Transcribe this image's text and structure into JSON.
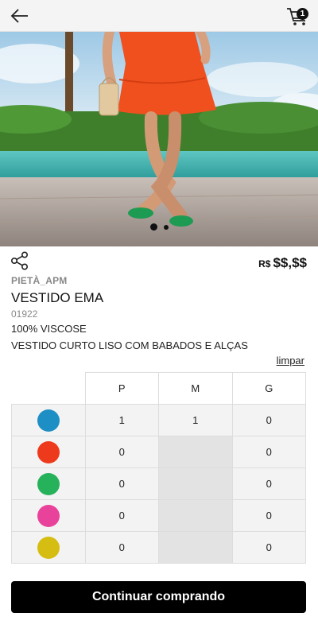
{
  "header": {
    "back_icon": "arrow-left-icon",
    "cart_icon": "cart-icon",
    "cart_count": "1"
  },
  "gallery": {
    "slide_count": 2,
    "active_index": 0,
    "image_description_icon": "product-photo"
  },
  "product": {
    "share_icon": "share-icon",
    "currency": "R$",
    "price": "$$,$$",
    "brand": "PIETÀ_APM",
    "name": "VESTIDO EMA",
    "code": "01922",
    "material": "100% VISCOSE",
    "description": "VESTIDO CURTO LISO COM BABADOS E ALÇAS"
  },
  "size_grid": {
    "clear_label": "limpar",
    "sizes": [
      "P",
      "M",
      "G"
    ],
    "rows": [
      {
        "color": "#1e8fc4",
        "quantities": [
          "1",
          "1",
          "0"
        ],
        "available": [
          true,
          true,
          true
        ]
      },
      {
        "color": "#ee3a1c",
        "quantities": [
          "0",
          "",
          "0"
        ],
        "available": [
          true,
          false,
          true
        ]
      },
      {
        "color": "#26b25a",
        "quantities": [
          "0",
          "",
          "0"
        ],
        "available": [
          true,
          false,
          true
        ]
      },
      {
        "color": "#e8429a",
        "quantities": [
          "0",
          "",
          "0"
        ],
        "available": [
          true,
          false,
          true
        ]
      },
      {
        "color": "#d6bd12",
        "quantities": [
          "0",
          "",
          "0"
        ],
        "available": [
          true,
          false,
          true
        ]
      }
    ]
  },
  "actions": {
    "continue_label": "Continuar comprando"
  }
}
